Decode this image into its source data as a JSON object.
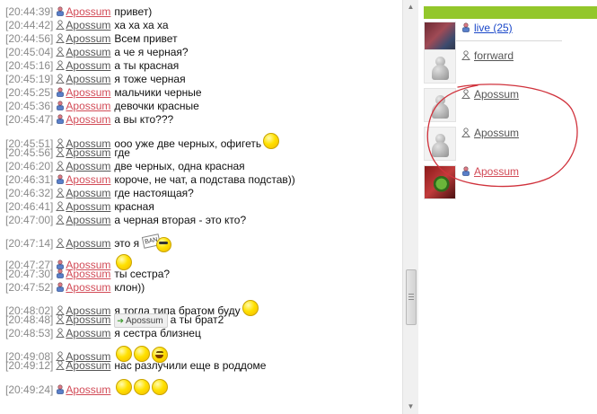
{
  "chat": {
    "messages": [
      {
        "time": "[20:44:39]",
        "gender": "f",
        "nick": "Apossum",
        "text": "привет)"
      },
      {
        "time": "[20:44:42]",
        "gender": "m",
        "nick": "Apossum",
        "text": "ха ха ха ха"
      },
      {
        "time": "[20:44:56]",
        "gender": "m",
        "nick": "Apossum",
        "text": "Всем привет"
      },
      {
        "time": "[20:45:04]",
        "gender": "m",
        "nick": "Apossum",
        "text": "а че я черная?"
      },
      {
        "time": "[20:45:16]",
        "gender": "m",
        "nick": "Apossum",
        "text": "а ты красная"
      },
      {
        "time": "[20:45:19]",
        "gender": "m",
        "nick": "Apossum",
        "text": "я тоже черная"
      },
      {
        "time": "[20:45:25]",
        "gender": "f",
        "nick": "Apossum",
        "text": "мальчики черные"
      },
      {
        "time": "[20:45:36]",
        "gender": "f",
        "nick": "Apossum",
        "text": "девочки красные"
      },
      {
        "time": "[20:45:47]",
        "gender": "f",
        "nick": "Apossum",
        "text": "а вы кто???"
      },
      {
        "time": "[20:45:51]",
        "gender": "m",
        "nick": "Apossum",
        "text": "ооо уже две черных, офигеть"
      },
      {
        "time": "[20:45:56]",
        "gender": "m",
        "nick": "Apossum",
        "text": "где"
      },
      {
        "time": "[20:46:20]",
        "gender": "m",
        "nick": "Apossum",
        "text": "две черных, одна красная"
      },
      {
        "time": "[20:46:31]",
        "gender": "f",
        "nick": "Apossum",
        "text": "короче, не чат, а подстава подстав))"
      },
      {
        "time": "[20:46:32]",
        "gender": "m",
        "nick": "Apossum",
        "text": "где настоящая?"
      },
      {
        "time": "[20:46:41]",
        "gender": "m",
        "nick": "Apossum",
        "text": "красная"
      },
      {
        "time": "[20:47:00]",
        "gender": "m",
        "nick": "Apossum",
        "text": "а черная вторая - это кто?"
      },
      {
        "time": "[20:47:14]",
        "gender": "m",
        "nick": "Apossum",
        "text": "это я"
      },
      {
        "time": "[20:47:27]",
        "gender": "f",
        "nick": "Apossum",
        "text": ""
      },
      {
        "time": "[20:47:30]",
        "gender": "f",
        "nick": "Apossum",
        "text": "ты сестра?"
      },
      {
        "time": "[20:47:52]",
        "gender": "f",
        "nick": "Apossum",
        "text": "клон))"
      },
      {
        "time": "[20:48:02]",
        "gender": "m",
        "nick": "Apossum",
        "text": "я тогда типа братом буду"
      },
      {
        "time": "[20:48:48]",
        "gender": "m",
        "nick": "Apossum",
        "text": "а ты брат2",
        "mention": "Apossum"
      },
      {
        "time": "[20:48:53]",
        "gender": "m",
        "nick": "Apossum",
        "text": "я сестра близнец"
      },
      {
        "time": "[20:49:08]",
        "gender": "m",
        "nick": "Apossum",
        "text": ""
      },
      {
        "time": "[20:49:12]",
        "gender": "m",
        "nick": "Apossum",
        "text": "нас разлучили еще в роддоме"
      },
      {
        "time": "[20:49:24]",
        "gender": "f",
        "nick": "Apossum",
        "text": ""
      }
    ]
  },
  "icons": {
    "male": "male-user-icon",
    "female": "female-user-icon",
    "smiley": "smiley-icon",
    "laugh": "laughing-smiley-icon",
    "sign": "sign-smiley-icon",
    "inline_user": "arrow-icon",
    "colors": {
      "male": "#555555",
      "female": "#d24b57",
      "link": "#1a47c9",
      "header": "#93c72b"
    }
  },
  "sign_text": "BAN",
  "users": {
    "list": [
      {
        "name": "live (25)",
        "gender": "f",
        "style": "link"
      },
      {
        "name": "forrward",
        "gender": "m",
        "style": "m"
      },
      {
        "name": "Apossum",
        "gender": "m",
        "style": "m"
      },
      {
        "name": "Apossum",
        "gender": "m",
        "style": "m"
      },
      {
        "name": "Apossum",
        "gender": "f",
        "style": "f"
      }
    ]
  }
}
